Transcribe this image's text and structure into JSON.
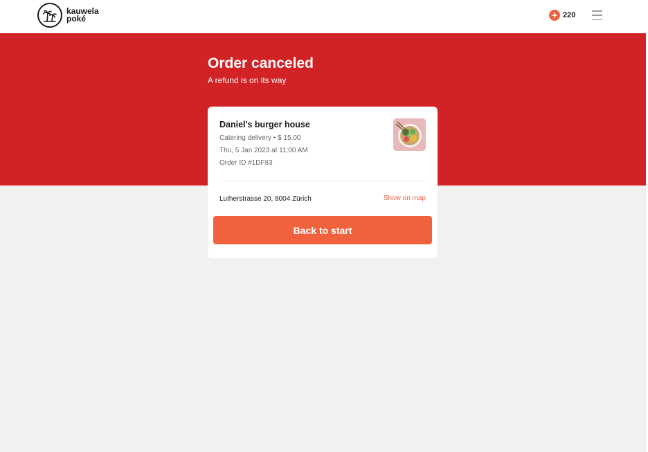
{
  "brand": {
    "name_line1": "kauwela",
    "name_line2": "poké",
    "logo_icon": "palm-trees-icon"
  },
  "header": {
    "points_value": "220",
    "points_icon": "sparkle-icon",
    "menu_icon": "hamburger-menu-icon"
  },
  "hero": {
    "title": "Order canceled",
    "subtitle": "A refund is on its way"
  },
  "order": {
    "restaurant": "Daniel's burger house",
    "details": "Catering delivery • $ 15.00",
    "datetime": "Thu, 5 Jan 2023 at 11:00 AM",
    "order_id": "Order ID #1DF83",
    "address": "Lutherstrasse 20, 8004 Zürich",
    "map_link": "Show on map",
    "image_icon": "food-bowl-image"
  },
  "actions": {
    "back_label": "Back to start"
  },
  "colors": {
    "banner": "#d12325",
    "accent": "#f0623d",
    "background": "#f1f1f1"
  }
}
